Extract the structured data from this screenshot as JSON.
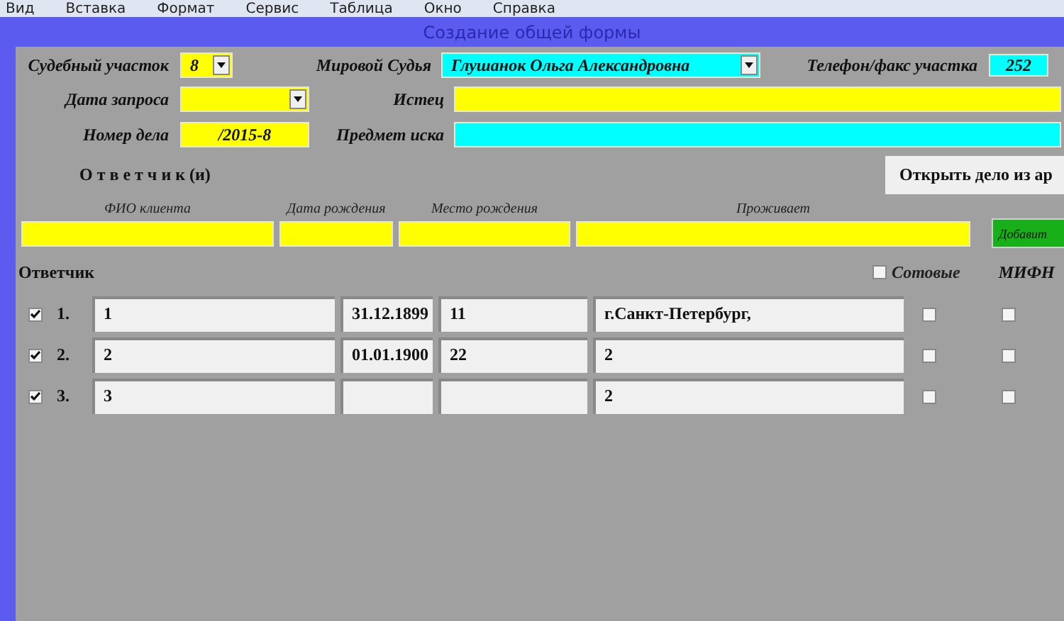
{
  "menu": [
    "Вид",
    "Вставка",
    "Формат",
    "Сервис",
    "Таблица",
    "Окно",
    "Справка"
  ],
  "window": {
    "title": "Создание общей формы"
  },
  "court_section": {
    "label": "Судебный участок",
    "value": "8"
  },
  "judge": {
    "label": "Мировой Судья",
    "value": "Глушанок Ольга Александровна"
  },
  "phone": {
    "label": "Телефон/факс участка",
    "value": "252"
  },
  "request_date": {
    "label": "Дата запроса"
  },
  "plaintiff": {
    "label": "Истец"
  },
  "case_number": {
    "label": "Номер дела",
    "value": "/2015-8"
  },
  "claim_subject": {
    "label": "Предмет иска"
  },
  "respondents_heading": "О т в е т ч и к (и)",
  "open_archive_button": "Открыть дело из ар",
  "new_respondent": {
    "columns": [
      "ФИО клиента",
      "Дата рождения",
      "Место рождения",
      "Проживает"
    ],
    "add_button": "Добавит"
  },
  "list": {
    "title": "Ответчик",
    "mobile": {
      "label": "Сотовые",
      "checked": false
    },
    "column_2": "МИФН",
    "rows": [
      {
        "checked": true,
        "number": "1.",
        "name": "1",
        "birth_date": "31.12.1899",
        "birth_place": "11",
        "address": "г.Санкт-Петербург,",
        "mobile": false,
        "mifn": false
      },
      {
        "checked": true,
        "number": "2.",
        "name": "2",
        "birth_date": "01.01.1900",
        "birth_place": "22",
        "address": "2",
        "mobile": false,
        "mifn": false
      },
      {
        "checked": true,
        "number": "3.",
        "name": "3",
        "birth_date": "",
        "birth_place": "",
        "address": "2",
        "mobile": false,
        "mifn": false
      }
    ]
  }
}
